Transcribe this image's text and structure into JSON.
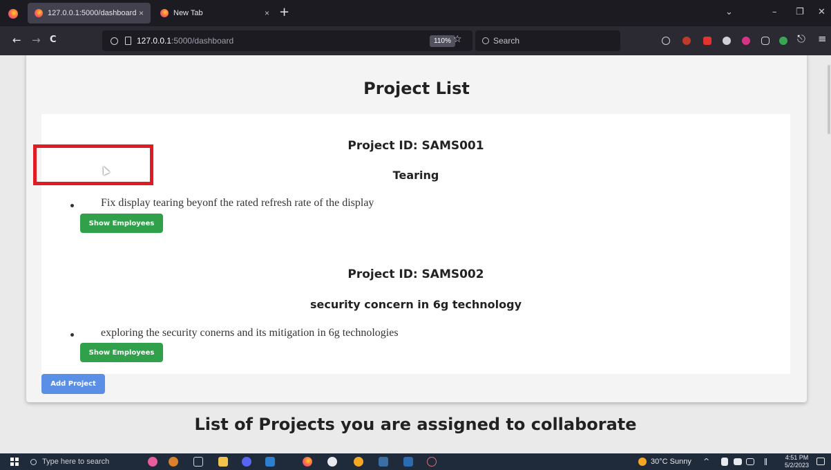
{
  "browser": {
    "tabs": [
      {
        "title": "127.0.0.1:5000/dashboard",
        "close": "×"
      },
      {
        "title": "New Tab",
        "close": "×"
      }
    ],
    "new_tab": "+",
    "window_controls": {
      "list": "⌄",
      "minimize": "–",
      "restore": "❐",
      "close": "✕"
    },
    "nav": {
      "back": "←",
      "forward": "→",
      "reload": "C"
    },
    "url_host": "127.0.0.1",
    "url_path": ":5000/dashboard",
    "zoom": "110%",
    "bookmark": "☆",
    "search_placeholder": "Search",
    "menu": "≡",
    "share": "⎋"
  },
  "page": {
    "title": "Project List",
    "projects": [
      {
        "id_label": "Project ID: SAMS001",
        "name": "Tearing",
        "description": "Fix display tearing beyonf the rated refresh rate of the display",
        "button": "Show Employees"
      },
      {
        "id_label": "Project ID: SAMS002",
        "name": "security concern in 6g technology",
        "description": "exploring the security conerns and its mitigation in 6g technologies",
        "button": "Show Employees"
      }
    ],
    "add_button": "Add Project",
    "collab_title": "List of Projects you are assigned to collaborate"
  },
  "taskbar": {
    "search_placeholder": "Type here to search",
    "weather": "30°C  Sunny",
    "tray": "^",
    "time": "4:51 PM",
    "date": "5/2/2023"
  },
  "colors": {
    "show_button": "#31a04a",
    "add_button": "#5b8fe6",
    "highlight": "#e01b24"
  }
}
